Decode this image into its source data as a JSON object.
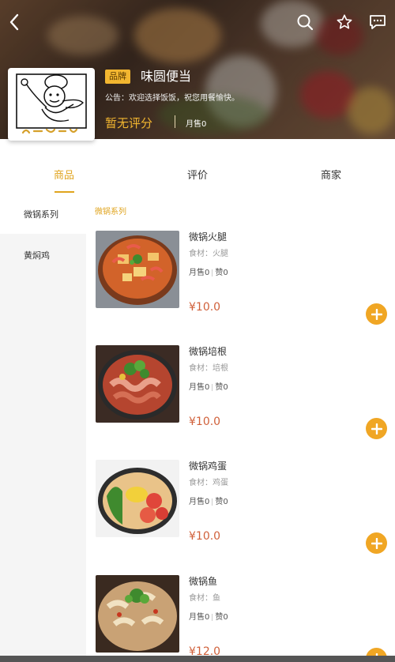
{
  "header": {
    "shop_name": "味圆便当",
    "brand_badge": "品牌",
    "notice": "公告：欢迎选择饭饭，祝您用餐愉快。",
    "rating": "暂无评分",
    "monthly_sales": "月售0"
  },
  "tabs": [
    {
      "label": "商品",
      "active": true
    },
    {
      "label": "评价",
      "active": false
    },
    {
      "label": "商家",
      "active": false
    }
  ],
  "sidebar": {
    "categories": [
      {
        "label": "微锅系列",
        "active": true
      },
      {
        "label": "黄焖鸡",
        "active": false
      }
    ]
  },
  "list": {
    "section_title": "微锅系列",
    "items": [
      {
        "name": "微锅火腿",
        "ingredient": "食材：火腿",
        "sales": "月售0",
        "likes": "赞0",
        "price": "¥10.0"
      },
      {
        "name": "微锅培根",
        "ingredient": "食材：培根",
        "sales": "月售0",
        "likes": "赞0",
        "price": "¥10.0"
      },
      {
        "name": "微锅鸡蛋",
        "ingredient": "食材：鸡蛋",
        "sales": "月售0",
        "likes": "赞0",
        "price": "¥10.0"
      },
      {
        "name": "微锅鱼",
        "ingredient": "食材：鱼",
        "sales": "月售0",
        "likes": "赞0",
        "price": "¥12.0"
      }
    ]
  },
  "icons": {
    "back": "chevron-left-icon",
    "search": "search-icon",
    "favorite": "star-icon",
    "message": "message-icon",
    "add": "plus-circle-icon"
  },
  "colors": {
    "accent": "#e0a41e",
    "price": "#d0603a",
    "add_button": "#f0a624",
    "badge": "#f2b630"
  }
}
